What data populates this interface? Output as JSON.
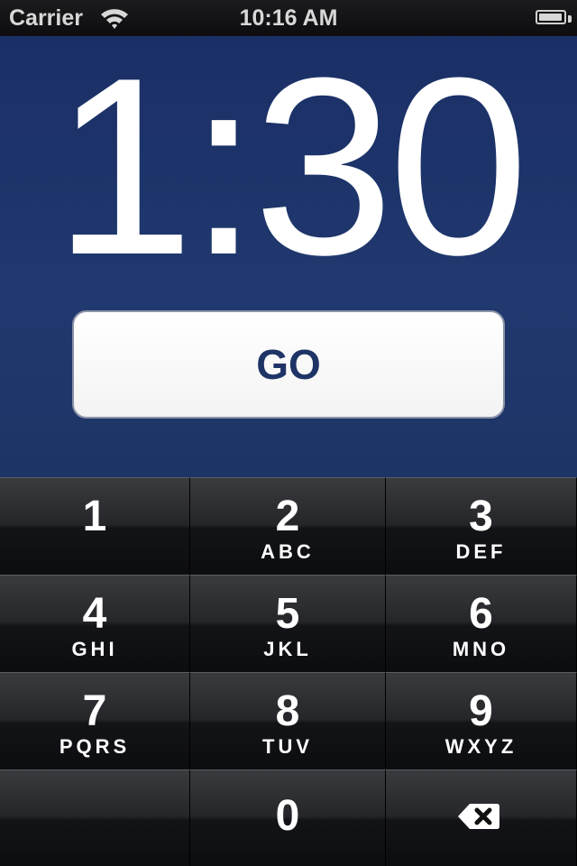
{
  "status_bar": {
    "carrier": "Carrier",
    "time": "10:16 AM",
    "wifi_icon": "wifi-icon",
    "battery_icon": "battery-icon",
    "battery_level": 0.95
  },
  "timer": {
    "display": "1:30",
    "go_label": "GO",
    "background_color": "#1e3366",
    "text_color": "#1e3366"
  },
  "keypad": {
    "keys": [
      {
        "digit": "1",
        "letters": ""
      },
      {
        "digit": "2",
        "letters": "ABC"
      },
      {
        "digit": "3",
        "letters": "DEF"
      },
      {
        "digit": "4",
        "letters": "GHI"
      },
      {
        "digit": "5",
        "letters": "JKL"
      },
      {
        "digit": "6",
        "letters": "MNO"
      },
      {
        "digit": "7",
        "letters": "PQRS"
      },
      {
        "digit": "8",
        "letters": "TUV"
      },
      {
        "digit": "9",
        "letters": "WXYZ"
      },
      {
        "digit": "0",
        "letters": ""
      }
    ],
    "delete_icon": "backspace-icon"
  }
}
